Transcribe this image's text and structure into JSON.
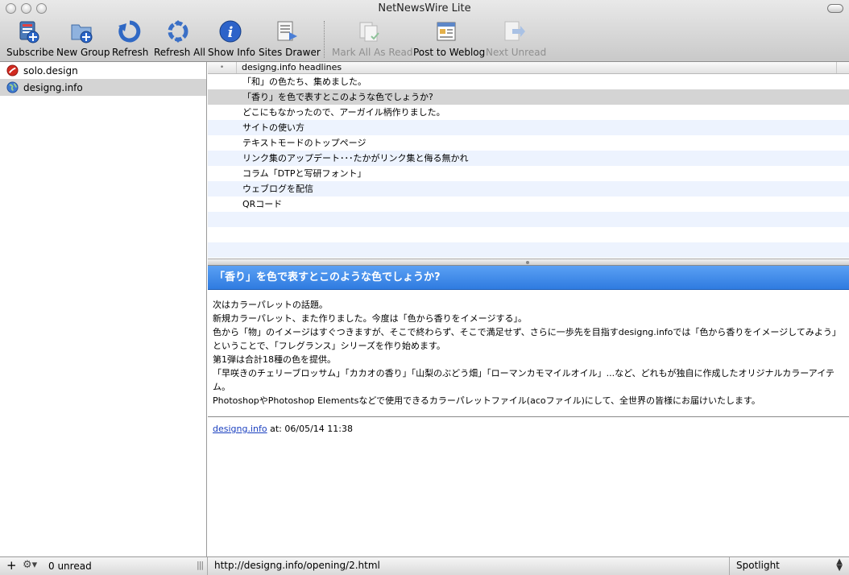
{
  "window": {
    "title": "NetNewsWire Lite"
  },
  "toolbar": [
    {
      "label": "Subscribe",
      "icon": "subscribe-icon",
      "enabled": true
    },
    {
      "label": "New Group",
      "icon": "new-group-icon",
      "enabled": true
    },
    {
      "label": "Refresh",
      "icon": "refresh-icon",
      "enabled": true
    },
    {
      "label": "Refresh All",
      "icon": "refresh-all-icon",
      "enabled": true
    },
    {
      "label": "Show Info",
      "icon": "info-icon",
      "enabled": true
    },
    {
      "label": "Sites Drawer",
      "icon": "sites-drawer-icon",
      "enabled": true
    },
    {
      "label": "Mark All As Read",
      "icon": "mark-all-read-icon",
      "enabled": false
    },
    {
      "label": "Post to Weblog",
      "icon": "post-weblog-icon",
      "enabled": true
    },
    {
      "label": "Next Unread",
      "icon": "next-unread-icon",
      "enabled": false
    }
  ],
  "subscriptions": [
    {
      "label": "solo.design",
      "icon": "red-feed-icon",
      "selected": false
    },
    {
      "label": "designg.info",
      "icon": "globe-icon",
      "selected": true
    }
  ],
  "headlines": {
    "header_title": "designg.info headlines",
    "header_sort_symbol": "•",
    "items": [
      {
        "title": "「和」の色たち、集めました。",
        "selected": false
      },
      {
        "title": "「香り」を色で表すとこのような色でしょうか?",
        "selected": true
      },
      {
        "title": "どこにもなかったので、アーガイル柄作りました。",
        "selected": false
      },
      {
        "title": "サイトの使い方",
        "selected": false
      },
      {
        "title": "テキストモードのトップページ",
        "selected": false
      },
      {
        "title": "リンク集のアップデート･･･たかがリンク集と侮る無かれ",
        "selected": false
      },
      {
        "title": "コラム「DTPと写研フォント」",
        "selected": false
      },
      {
        "title": "ウェブログを配信",
        "selected": false
      },
      {
        "title": "QRコード",
        "selected": false
      },
      {
        "title": "",
        "selected": false
      },
      {
        "title": "",
        "selected": false
      },
      {
        "title": "",
        "selected": false
      }
    ]
  },
  "article": {
    "title": "「香り」を色で表すとこのような色でしょうか?",
    "body": [
      "次はカラーパレットの話題。",
      "新規カラーパレット、また作りました。今度は「色から香りをイメージする」。",
      "色から「物」のイメージはすぐつきますが、そこで終わらず、そこで満足せず、さらに一歩先を目指すdesigng.infoでは「色から香りをイメージしてみよう」ということで、「フレグランス」シリーズを作り始めます。",
      "第1弾は合計18種の色を提供。",
      "「早咲きのチェリーブロッサム」「カカオの香り」「山梨のぶどう畑」「ローマンカモマイルオイル」...など、どれもが独自に作成したオリジナルカラーアイテム。",
      "PhotoshopやPhotoshop Elementsなどで使用できるカラーパレットファイル(acoファイル)にして、全世界の皆様にお届けいたします。"
    ],
    "source_link": "designg.info",
    "date_text": " at: 06/05/14 11:38"
  },
  "statusbar": {
    "add_label": "+",
    "gear_label": "⚙▾",
    "unread_text": "0 unread",
    "grip": "|||",
    "url": "http://designg.info/opening/2.html",
    "search_scope": "Spotlight"
  },
  "colors": {
    "article_title_bg": "#3a86ea",
    "selection_gray": "#d4d4d4",
    "alt_row": "#edf3fe",
    "link": "#1a3fbf"
  }
}
